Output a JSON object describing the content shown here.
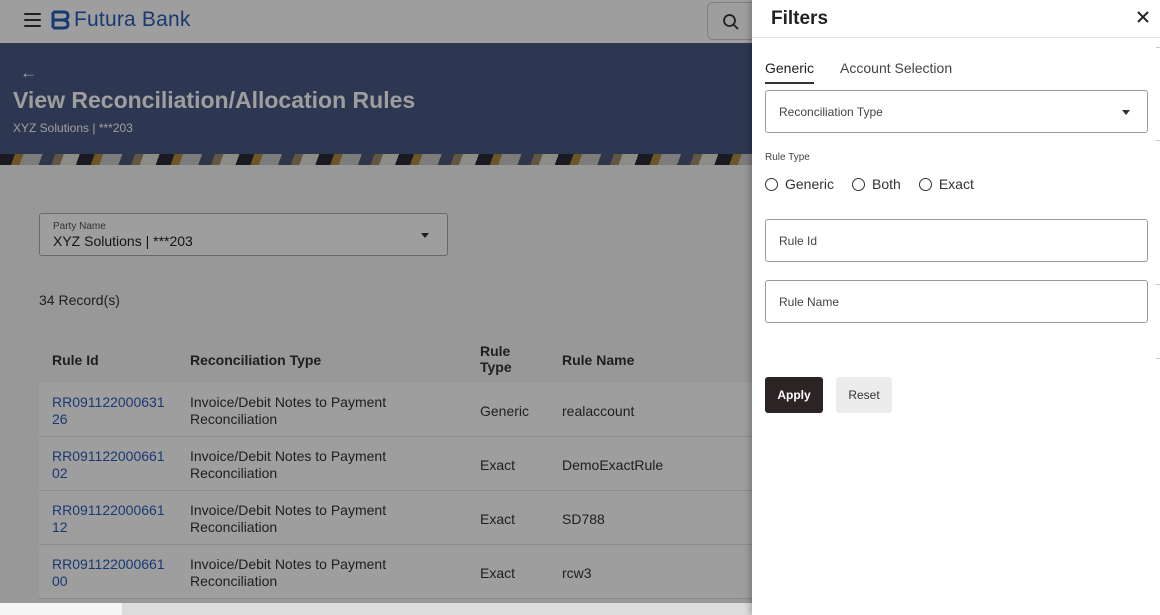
{
  "header": {
    "brand": "Futura Bank"
  },
  "page": {
    "back": "←",
    "title": "View Reconciliation/Allocation Rules",
    "subtitle": "XYZ Solutions | ***203"
  },
  "party": {
    "label": "Party Name",
    "value": "XYZ Solutions | ***203"
  },
  "records": "34 Record(s)",
  "table": {
    "headers": {
      "rule_id": "Rule Id",
      "recon_type": "Reconciliation Type",
      "rule_type_1": "Rule",
      "rule_type_2": "Type",
      "rule_name": "Rule Name"
    },
    "rows": [
      {
        "id_1": "RR091122000631",
        "id_2": "26",
        "type_1": "Invoice/Debit Notes to Payment",
        "type_2": "Reconciliation",
        "rule_type": "Generic",
        "rule_name": "realaccount"
      },
      {
        "id_1": "RR091122000661",
        "id_2": "02",
        "type_1": "Invoice/Debit Notes to Payment",
        "type_2": "Reconciliation",
        "rule_type": "Exact",
        "rule_name": "DemoExactRule"
      },
      {
        "id_1": "RR091122000661",
        "id_2": "12",
        "type_1": "Invoice/Debit Notes to Payment",
        "type_2": "Reconciliation",
        "rule_type": "Exact",
        "rule_name": "SD788"
      },
      {
        "id_1": "RR091122000661",
        "id_2": "00",
        "type_1": "Invoice/Debit Notes to Payment",
        "type_2": "Reconciliation",
        "rule_type": "Exact",
        "rule_name": "rcw3"
      }
    ]
  },
  "filters": {
    "title": "Filters",
    "tabs": [
      "Generic",
      "Account Selection"
    ],
    "recon_type_placeholder": "Reconciliation Type",
    "rule_type_label": "Rule Type",
    "rule_type_options": [
      "Generic",
      "Both",
      "Exact"
    ],
    "rule_id_placeholder": "Rule Id",
    "rule_name_placeholder": "Rule Name",
    "apply": "Apply",
    "reset": "Reset"
  },
  "colors": {
    "brand": "#2a5db8",
    "banner": "#4a5a84",
    "apply_button": "#2c2424"
  },
  "icons": [
    "hamburger-icon",
    "futura-logo-icon",
    "search-icon",
    "back-arrow-icon",
    "close-icon",
    "chevron-down-icon"
  ]
}
